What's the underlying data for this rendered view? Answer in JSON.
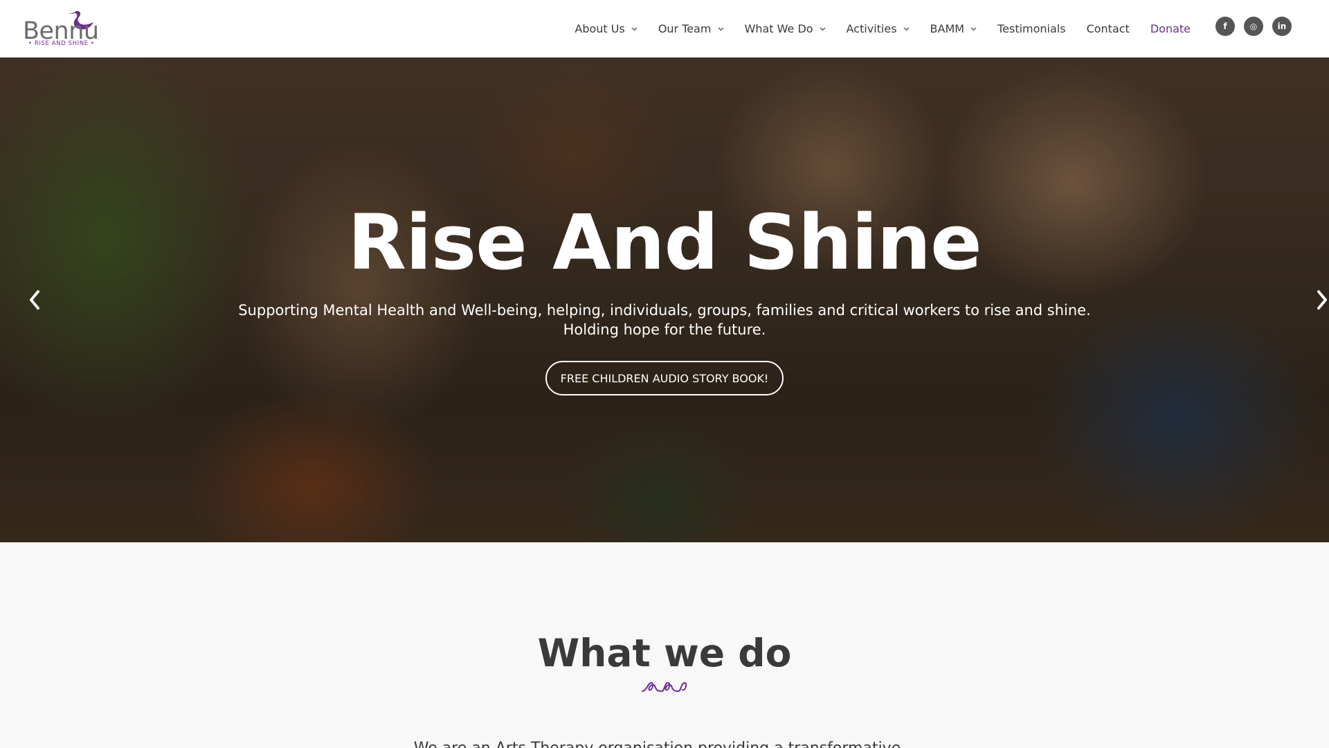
{
  "brand": {
    "name": "Bennu",
    "tagline": "• RISE AND SHINE •",
    "accent_color": "#6e2c91"
  },
  "nav": {
    "items": [
      {
        "label": "About Us",
        "dropdown": true
      },
      {
        "label": "Our Team",
        "dropdown": true
      },
      {
        "label": "What We Do",
        "dropdown": true
      },
      {
        "label": "Activities",
        "dropdown": true
      },
      {
        "label": "BAMM",
        "dropdown": true
      },
      {
        "label": "Testimonials",
        "dropdown": false
      },
      {
        "label": "Contact",
        "dropdown": false
      },
      {
        "label": "Donate",
        "dropdown": false
      }
    ]
  },
  "socials": [
    {
      "name": "facebook-icon",
      "glyph": "f"
    },
    {
      "name": "instagram-icon",
      "glyph": "◎"
    },
    {
      "name": "linkedin-icon",
      "glyph": "in"
    }
  ],
  "hero": {
    "title": "Rise And Shine",
    "subtitle_line1": "Supporting Mental Health and Well-being, helping, individuals, groups, families and critical workers to rise and shine.",
    "subtitle_line2": "Holding hope for the future.",
    "button_label": "FREE CHILDREN AUDIO STORY BOOK!"
  },
  "section": {
    "title": "What we do",
    "text": "We are an Arts Therapy organisation providing a transformative..."
  }
}
